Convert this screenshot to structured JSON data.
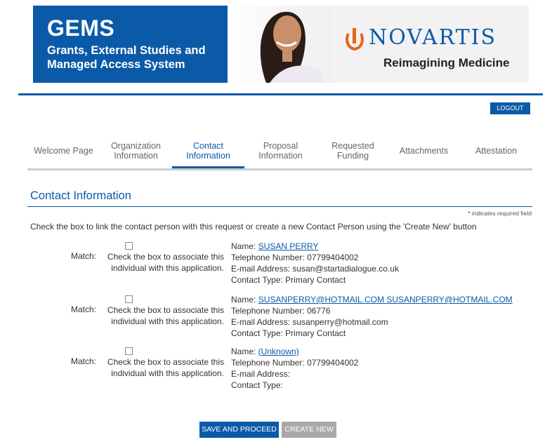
{
  "banner": {
    "title": "GEMS",
    "subtitle": "Grants, External Studies and Managed Access System",
    "brand": "NOVARTIS",
    "tagline": "Reimagining Medicine"
  },
  "header": {
    "logout_label": "LOGOUT"
  },
  "tabs": [
    {
      "label": "Welcome Page",
      "active": false
    },
    {
      "label": "Organization Information",
      "active": false
    },
    {
      "label": "Contact Information",
      "active": true
    },
    {
      "label": "Proposal Information",
      "active": false
    },
    {
      "label": "Requested Funding",
      "active": false
    },
    {
      "label": "Attachments",
      "active": false
    },
    {
      "label": "Attestation",
      "active": false
    }
  ],
  "section": {
    "title": "Contact Information",
    "required_star": "*",
    "required_note": "indicates required field",
    "instructions": "Check the box to link the contact person with this request or create a new Contact Person using the 'Create New' button"
  },
  "contacts": [
    {
      "match_label": "Match:",
      "match_help": "Check the box to associate this individual with this application.",
      "name_label": "Name:",
      "name": "SUSAN PERRY",
      "phone": "Telephone Number: 07799404002",
      "email": "E-mail Address: susan@startadialogue.co.uk",
      "type": "Contact Type: Primary Contact"
    },
    {
      "match_label": "Match:",
      "match_help": "Check the box to associate this individual with this application.",
      "name_label": "Name:",
      "name": "SUSANPERRY@HOTMAIL.COM SUSANPERRY@HOTMAIL.COM",
      "phone": "Telephone Number: 06776",
      "email": "E-mail Address: susanperry@hotmail.com",
      "type": "Contact Type: Primary Contact"
    },
    {
      "match_label": "Match:",
      "match_help": "Check the box to associate this individual with this application.",
      "name_label": "Name:",
      "name": "(Unknown)",
      "phone": "Telephone Number: 07799404002",
      "email": "E-mail Address:",
      "type": "Contact Type:"
    }
  ],
  "buttons": {
    "save": "SAVE AND PROCEED",
    "create_new": "CREATE NEW"
  },
  "colors": {
    "brand_blue": "#0b5aa8",
    "disabled_gray": "#a9a9a9",
    "required_red": "#cc0000"
  }
}
